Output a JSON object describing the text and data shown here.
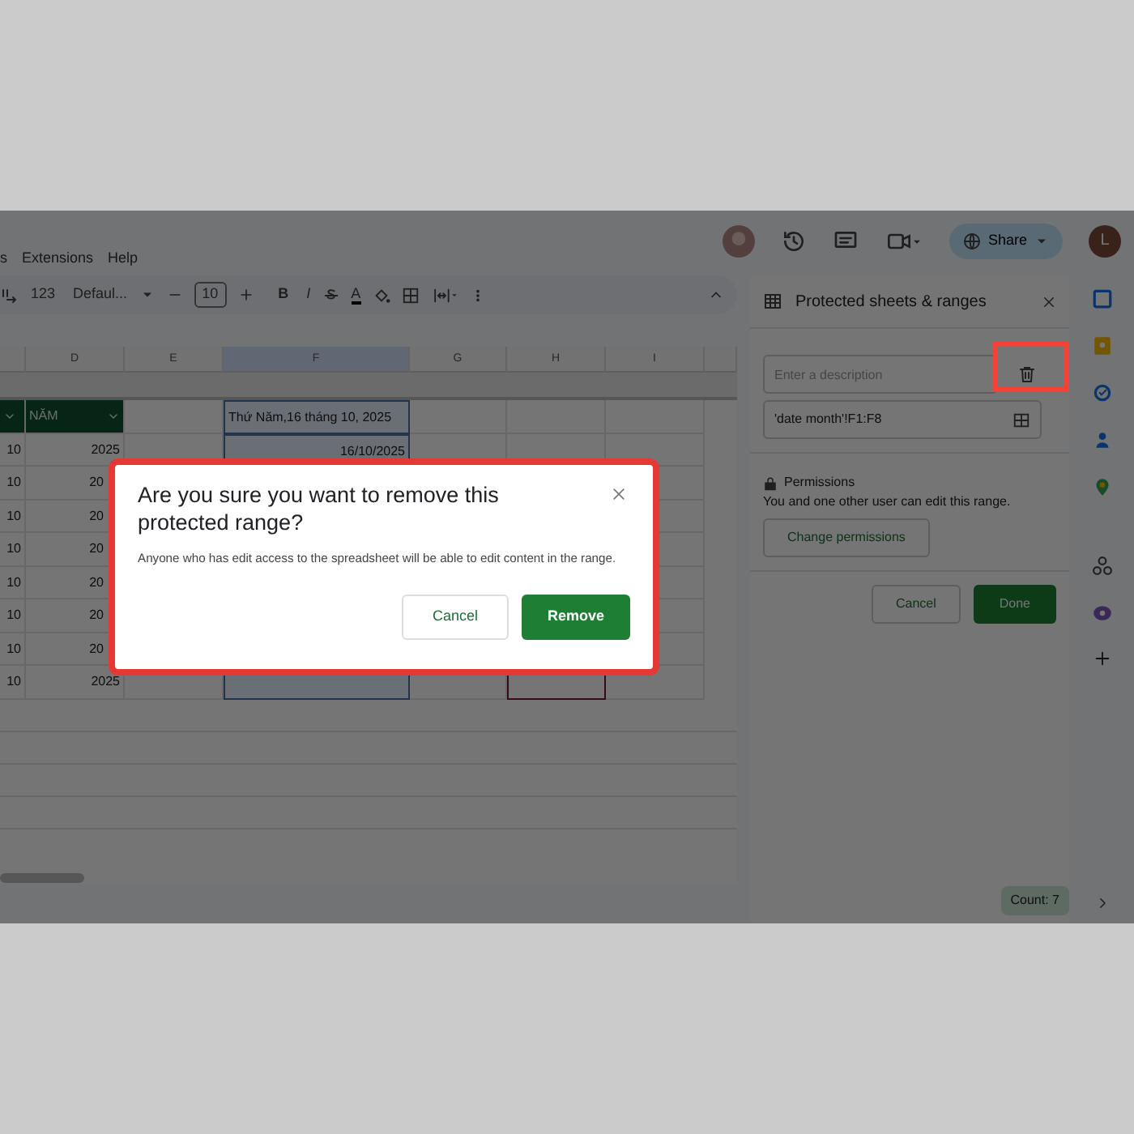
{
  "menu": [
    "s",
    "Extensions",
    "Help"
  ],
  "share": {
    "label": "Share"
  },
  "account": {
    "initial": "L"
  },
  "toolbar": {
    "number_format": "123",
    "font": "Defaul...",
    "font_size": "10",
    "bold": "B",
    "italic": "I",
    "text_color": "A"
  },
  "grid": {
    "columns": [
      {
        "label": "D",
        "selected": false,
        "active": false
      },
      {
        "label": "E",
        "selected": false,
        "active": false
      },
      {
        "label": "F",
        "selected": true,
        "active": false
      },
      {
        "label": "G",
        "selected": false,
        "active": false
      },
      {
        "label": "H",
        "selected": false,
        "active": true
      },
      {
        "label": "I",
        "selected": false,
        "active": false
      }
    ],
    "rows": [
      {
        "kind": "header",
        "active": false,
        "D": "NĂM",
        "F": "Thứ Năm,16 tháng 10, 2025"
      },
      {
        "kind": "data",
        "active": false,
        "first": "10",
        "D": "2025",
        "F": "16/10/2025"
      },
      {
        "kind": "covered",
        "active": false,
        "first": "10",
        "D": "20"
      },
      {
        "kind": "covered",
        "active": false,
        "first": "10",
        "D": "20"
      },
      {
        "kind": "covered",
        "active": false,
        "first": "10",
        "D": "20"
      },
      {
        "kind": "covered",
        "active": false,
        "first": "10",
        "D": "20"
      },
      {
        "kind": "covered",
        "active": false,
        "first": "10",
        "D": "20"
      },
      {
        "kind": "covered",
        "active": false,
        "first": "10",
        "D": "20"
      },
      {
        "kind": "data",
        "active": true,
        "first": "10",
        "D": "2025"
      }
    ]
  },
  "panel": {
    "title": "Protected sheets & ranges",
    "description_placeholder": "Enter a description",
    "range": "'date month'!F1:F8",
    "permissions_title": "Permissions",
    "permissions_text": "You and one other user can edit this range.",
    "change_button": "Change permissions",
    "cancel": "Cancel",
    "done": "Done"
  },
  "status_bar": {
    "count": "Count: 7"
  },
  "dialog": {
    "title": "Are you sure you want to remove this protected range?",
    "body": "Anyone who has edit access to the spreadsheet will be able to edit content in the range.",
    "cancel": "Cancel",
    "confirm": "Remove"
  }
}
